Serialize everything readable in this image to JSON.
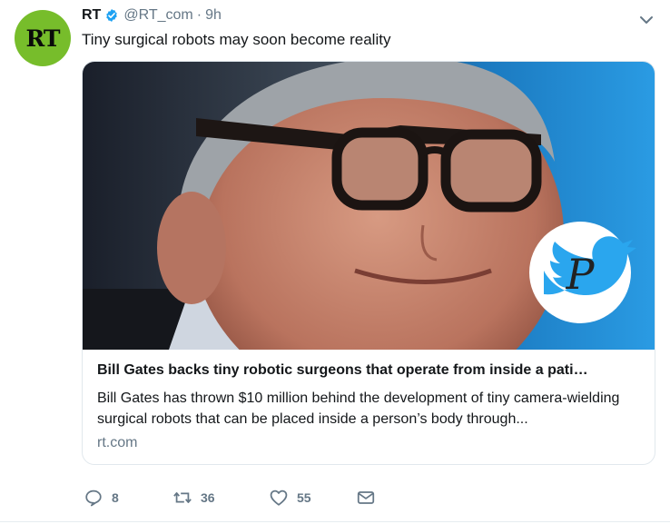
{
  "tweet": {
    "avatar_text": "RT",
    "name": "RT",
    "handle": "@RT_com",
    "separator": "·",
    "time": "9h",
    "text": "Tiny surgical robots may soon become reality"
  },
  "card": {
    "title": "Bill Gates backs tiny robotic surgeons that operate from inside a pati…",
    "description": "Bill Gates has thrown $10 million behind the development of tiny camera-wielding surgical robots that can be placed inside a person’s body through...",
    "domain": "rt.com",
    "watermark_letter": "P"
  },
  "actions": {
    "reply_count": "8",
    "retweet_count": "36",
    "like_count": "55"
  },
  "colors": {
    "avatar_bg": "#77bd2b",
    "verified": "#1da1f2",
    "muted": "#657786",
    "image_bg": "#1b8fd6"
  },
  "icons": [
    "verified-icon",
    "chevron-down-icon",
    "reply-icon",
    "retweet-icon",
    "like-icon",
    "message-icon",
    "twitter-bird-icon"
  ]
}
